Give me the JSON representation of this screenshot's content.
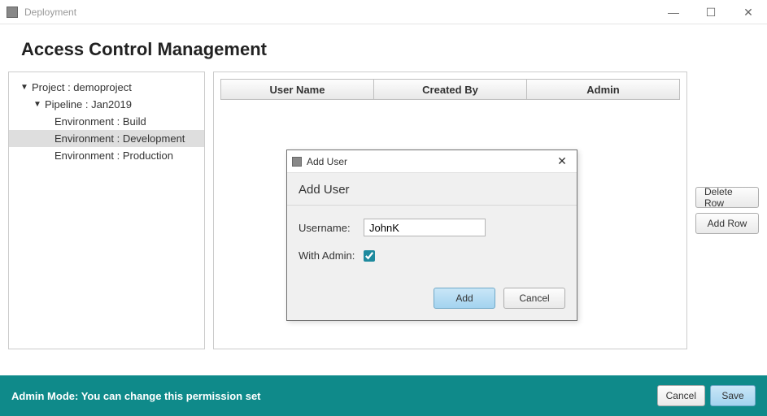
{
  "titlebar": {
    "title": "Deployment"
  },
  "header": {
    "title": "Access Control Management"
  },
  "tree": {
    "project": "Project : demoproject",
    "pipeline": "Pipeline : Jan2019",
    "envs": [
      "Environment : Build",
      "Environment : Development",
      "Environment : Production"
    ]
  },
  "table": {
    "cols": [
      "User Name",
      "Created By",
      "Admin"
    ]
  },
  "side": {
    "delete": "Delete Row",
    "add": "Add Row"
  },
  "dialog": {
    "winTitle": "Add User",
    "heading": "Add User",
    "usernameLabel": "Username:",
    "usernameValue": "JohnK",
    "withAdminLabel": "With Admin:",
    "withAdminChecked": true,
    "addBtn": "Add",
    "cancelBtn": "Cancel"
  },
  "footer": {
    "status": "Admin Mode: You can change this permission set",
    "cancel": "Cancel",
    "save": "Save"
  }
}
